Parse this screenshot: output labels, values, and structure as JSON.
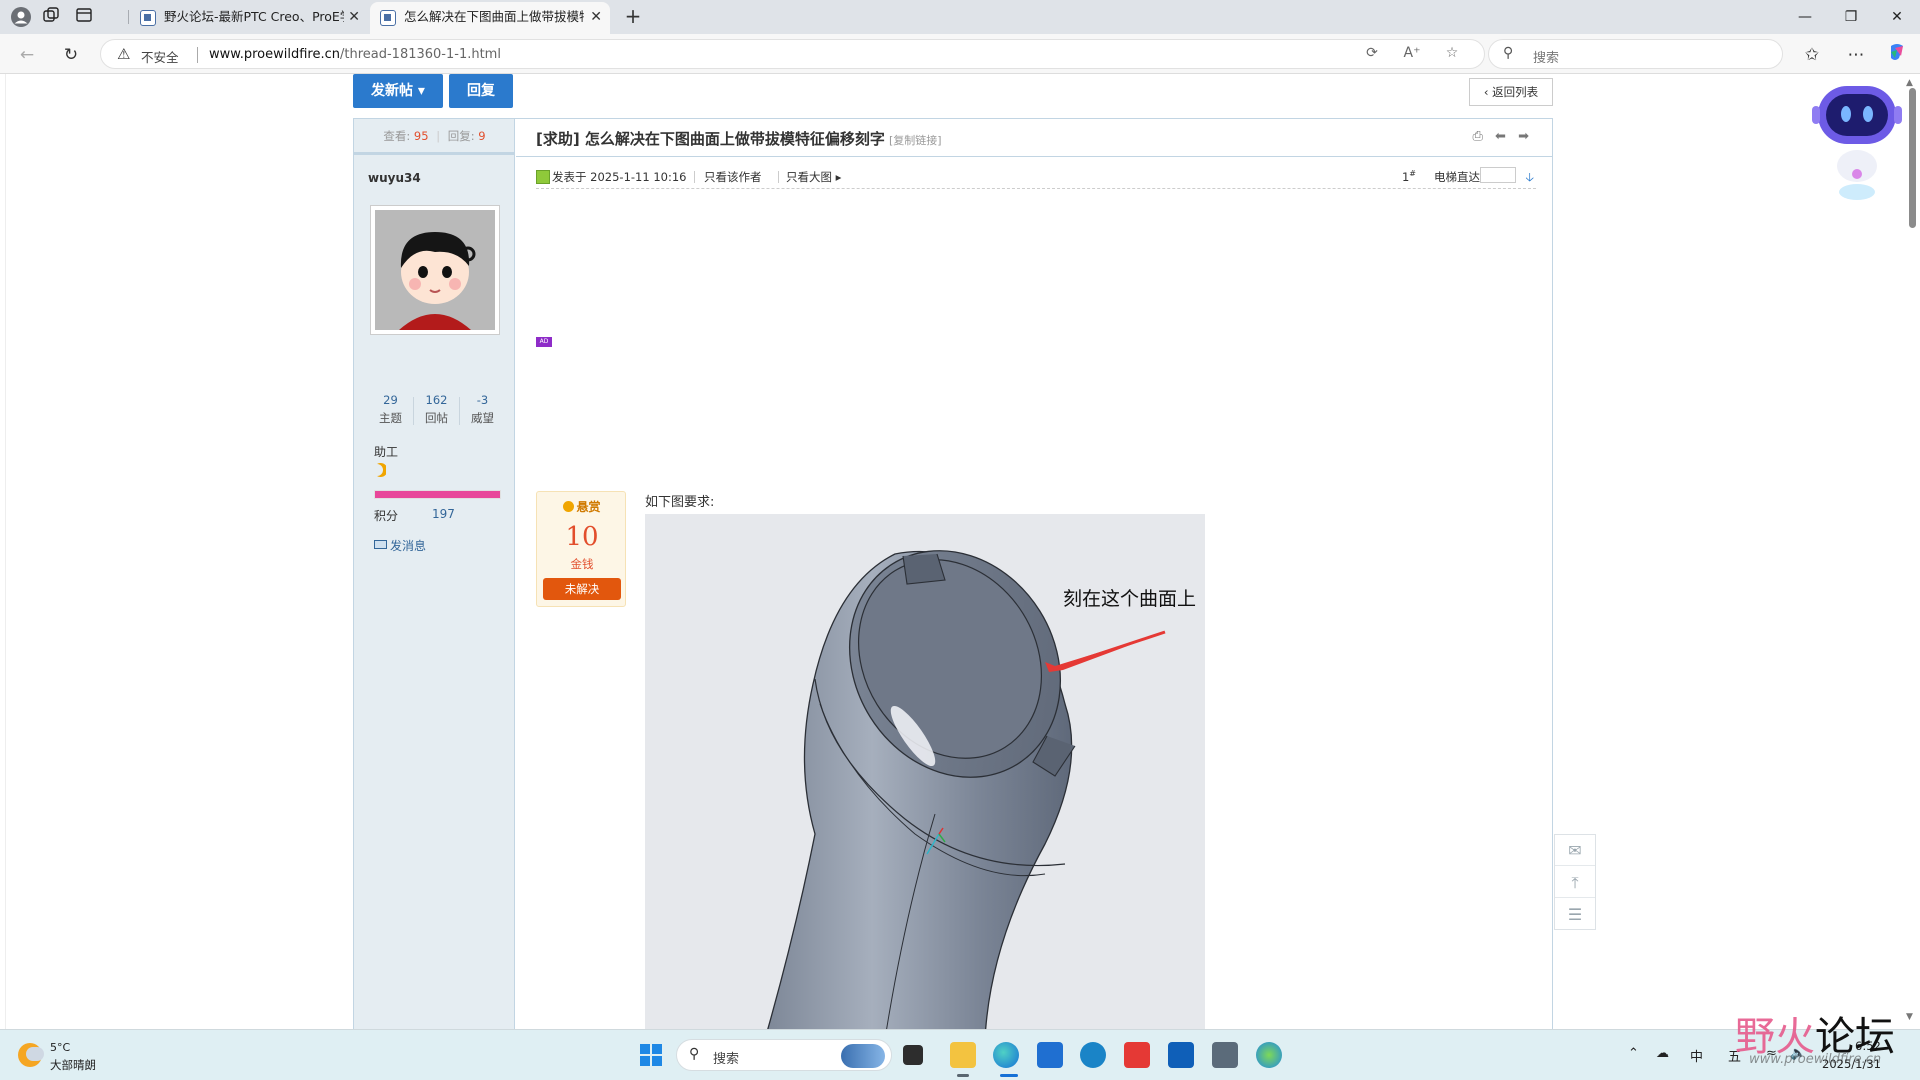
{
  "browser": {
    "tabs": [
      {
        "title": "野火论坛-最新PTC Creo、ProE学",
        "close": "✕"
      },
      {
        "title": "怎么解决在下图曲面上做带拔模特",
        "close": "✕"
      }
    ],
    "address": {
      "security_label": "不安全",
      "host": "www.proewildfire.cn",
      "path": "/thread-181360-1-1.html"
    },
    "search_placeholder": "搜索"
  },
  "page": {
    "buttons": {
      "new_post": "发新帖",
      "new_post_caret": "▾",
      "reply": "回复",
      "back_to_list": "‹ 返回列表"
    },
    "stats": {
      "views_label": "查看:",
      "views": "95",
      "sep": "|",
      "replies_label": "回复:",
      "replies": "9"
    },
    "author": {
      "name": "wuyu34",
      "counts": [
        {
          "value": "29",
          "label": "主题"
        },
        {
          "value": "162",
          "label": "回帖"
        },
        {
          "value": "-3",
          "label": "威望"
        }
      ],
      "rank": "助工",
      "progress_fraction": 1.0,
      "score_label": "积分",
      "score": "197",
      "send_message": "发消息"
    },
    "thread": {
      "title": "[求助] 怎么解决在下图曲面上做带拔模特征偏移刻字",
      "copy_link": "[复制链接]",
      "posted": "发表于 2025-1-11 10:16",
      "only_author": "只看该作者",
      "big_image": "只看大图",
      "big_image_caret": "▸",
      "floor": "1",
      "floor_sup": "#",
      "goto_label": "电梯直达",
      "ad_badge": "AD",
      "reward": {
        "label": "悬赏",
        "amount": "10",
        "unit": "金钱",
        "status": "未解决"
      },
      "body_text": "如下图要求:",
      "image_annotation": "刻在这个曲面上"
    }
  },
  "taskbar": {
    "weather_temp": "5°C",
    "weather_desc": "大部晴朗",
    "search_placeholder": "搜索",
    "tray_ime": "中",
    "tray_wubi": "五",
    "clock_time": "6:52",
    "clock_date": "2025/1/31"
  },
  "watermark": {
    "main_a": "野火",
    "main_b": "论坛",
    "sub": "www.proewildfire.cn"
  },
  "colors": {
    "accent": "#2b7acd",
    "reward_status": "#e2570d",
    "progress": "#e8479a",
    "price": "#e24e2c"
  }
}
